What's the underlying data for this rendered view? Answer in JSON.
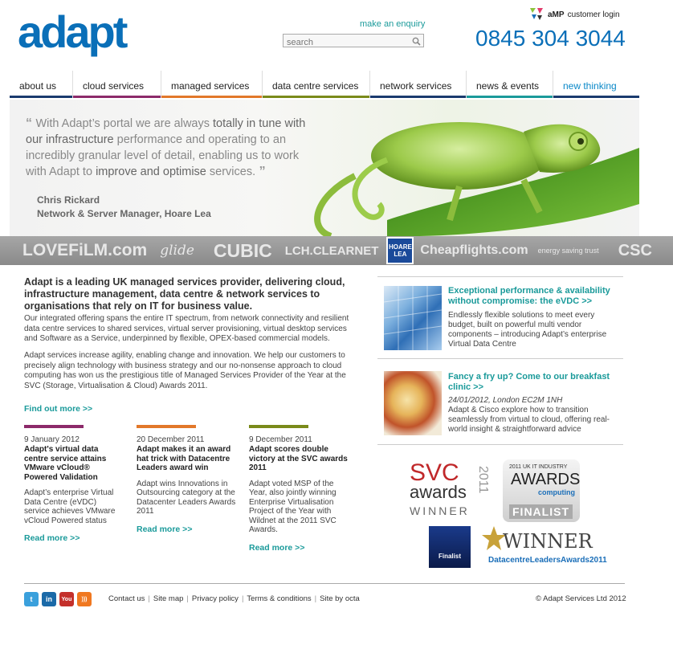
{
  "header": {
    "logo_text": "adapt",
    "enquiry_link": "make an enquiry",
    "search_placeholder": "search",
    "amp_login_brand": "aMP",
    "amp_login_text": "customer login",
    "phone": "0845 304 3044"
  },
  "nav": [
    {
      "label": "about us",
      "color": "#1a3a6e"
    },
    {
      "label": "cloud services",
      "color": "#8c2a6a"
    },
    {
      "label": "managed services",
      "color": "#e2782a"
    },
    {
      "label": "data centre services",
      "color": "#7a8a1a"
    },
    {
      "label": "network services",
      "color": "#1a3a6e"
    },
    {
      "label": "news & events",
      "color": "#1a9a9a"
    },
    {
      "label": "new thinking",
      "color": "#1a3a6e"
    }
  ],
  "hero": {
    "quote_parts": [
      {
        "t": "“ ",
        "k": "qm"
      },
      {
        "t": "With Adapt’s portal we are always ",
        "k": "n"
      },
      {
        "t": "totally in tune with our infrastructure",
        "k": "b"
      },
      {
        "t": " performance and operating to an incredibly granular level of detail, enabling us to work with Adapt to ",
        "k": "n"
      },
      {
        "t": "improve and optimise",
        "k": "b"
      },
      {
        "t": " services.",
        "k": "n"
      },
      {
        "t": " ”",
        "k": "qm"
      }
    ],
    "name": "Chris Rickard",
    "role": "Network & Server Manager, Hoare Lea"
  },
  "clients": [
    "LOVEFiLM.com",
    "glide",
    "CUBIC",
    "LCH.CLEARNET",
    "HOARE LEA",
    "Cheapflights.com",
    "energy saving trust",
    "CSC"
  ],
  "intro": {
    "heading": "Adapt is a leading UK managed services provider, delivering cloud, infrastructure management, data centre & network services to organisations that rely on IT for business value.",
    "p1": "Our integrated offering spans the entire IT spectrum, from network connectivity and resilient data centre services to shared services, virtual server provisioning, virtual desktop services and Software as a Service, underpinned by flexible, OPEX-based commercial models.",
    "p2": "Adapt services increase agility, enabling change and innovation. We help our customers to precisely align technology with business strategy and our no-nonsense approach to cloud computing has won us the prestigious title of Managed Services Provider of the Year at the SVC (Storage, Virtualisation & Cloud) Awards 2011.",
    "find_more": "Find out more >>"
  },
  "news": [
    {
      "color": "#8c2a6a",
      "date": "9 January 2012",
      "title": "Adapt's virtual data centre service attains VMware vCloud® Powered Validation",
      "text": "Adapt’s enterprise Virtual Data Centre (eVDC) service achieves VMware vCloud Powered status",
      "more": "Read more >>"
    },
    {
      "color": "#e2782a",
      "date": "20 December 2011",
      "title": "Adapt makes it an award hat trick with Datacentre Leaders award win",
      "text": "Adapt wins Innovations in Outsourcing category at the Datacenter Leaders Awards 2011",
      "more": "Read more >>"
    },
    {
      "color": "#7a8a1a",
      "date": "9 December 2011",
      "title": "Adapt scores double victory at the SVC awards 2011",
      "text": "Adapt voted MSP of the Year, also jointly winning Enterprise Virtualisation Project of the Year with Wildnet at the 2011 SVC Awards.",
      "more": "Read more >>"
    }
  ],
  "features": [
    {
      "title": "Exceptional performance & availability without compromise: the eVDC >>",
      "text": "Endlessly flexible solutions to meet every budget, built on powerful multi vendor components – introducing Adapt’s enterprise Virtual Data Centre"
    },
    {
      "title": "Fancy a fry up? Come to our breakfast clinic >>",
      "subtitle": "24/01/2012, London EC2M 1NH",
      "text": "Adapt & Cisco explore how to transition seamlessly from virtual to cloud, offering real-world insight & straightforward advice"
    }
  ],
  "awards": {
    "svc": {
      "line1": "SVC",
      "line2": "awards",
      "year": "2011",
      "line3": "WINNER"
    },
    "uk": {
      "top": "2011 UK IT INDUSTRY",
      "main": "AWARDS",
      "sub": "computing",
      "bottom": "FINALIST"
    },
    "badge": {
      "text": "Finalist"
    },
    "leaders": {
      "main": "WINNER",
      "sub": "DatacentreLeadersAwards2011"
    }
  },
  "footer": {
    "social": [
      {
        "name": "twitter-icon",
        "glyph": "t",
        "color": "#3aa0dc"
      },
      {
        "name": "linkedin-icon",
        "glyph": "in",
        "color": "#1b6aa8"
      },
      {
        "name": "youtube-icon",
        "glyph": "You",
        "color": "#c4302b"
      },
      {
        "name": "rss-icon",
        "glyph": ")))",
        "color": "#f07820"
      }
    ],
    "links": [
      "Contact us",
      "Site map",
      "Privacy policy",
      "Terms & conditions",
      "Site by octa"
    ],
    "copyright": "© Adapt Services Ltd 2012"
  }
}
